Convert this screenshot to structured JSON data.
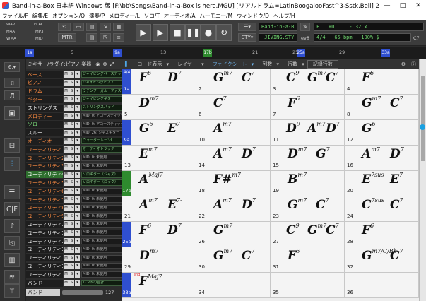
{
  "window": {
    "title": "Band-in-a-Box 日本語 Windows 版 [F:\\bb\\Songs\\Band-in-a-Box is here.MGU] [リアルドラム=LatinBoogalooFast^3-Sstk,Bell]  2:12 [ジャイビング アップビー...",
    "min": "—",
    "max": "□",
    "close": "✕"
  },
  "menu": [
    "ファイル/F",
    "編集/E",
    "オプション/O",
    "演奏/P",
    "メロディー/L",
    "ソロ/T",
    "オーディオ/A",
    "ハーモニー/M",
    "ウィンドウ/D",
    "ヘルプ/H"
  ],
  "toolbar": {
    "formats": [
      "WAV",
      "FLAC",
      "M4A",
      "MP3",
      "WMA",
      "MID"
    ],
    "mtr_label": "MTR",
    "song_name": "Band-in-a-B...",
    "style_name": "_JIVING.STY",
    "key": "F",
    "plus_label": "+0",
    "bar_from": "1",
    "bar_to": "32",
    "x_label": "x",
    "repeats": "1",
    "ev_label": "ev8",
    "time_sig": "4/4",
    "tempo": "65 bpm",
    "volume": "100%",
    "dollar_label": "$",
    "c7_label": "C7"
  },
  "timeline": {
    "ticks": [
      "5",
      "9",
      "13",
      "17",
      "21",
      "25",
      "29",
      "33"
    ],
    "markers": [
      "1a",
      "9a",
      "17b",
      "25a",
      "33a"
    ]
  },
  "mixer": {
    "header": "ミキサー/ラダイ:ピアノ 楽器",
    "tracks": [
      {
        "name": "ベース",
        "inst": "ジャイビングベースアップライト",
        "color": "orange",
        "sel": false
      },
      {
        "name": "ピアノ",
        "inst": "ジャイビングピアノ",
        "color": "orange",
        "sel": false
      },
      {
        "name": "ドラム",
        "inst": "ラテンブーガルーファスト",
        "color": "orange",
        "sel": false
      },
      {
        "name": "ギター",
        "inst": "ジャイビングギター",
        "color": "orange",
        "sel": false
      },
      {
        "name": "ストリングス",
        "inst": "ストリングスパッド",
        "color": "white",
        "sel": false
      },
      {
        "name": "メロディー",
        "inst": "MIDI 0: アコースティック",
        "color": "orange",
        "sel": false
      },
      {
        "name": "ソロ",
        "inst": "MIDI 0: アコースティック",
        "color": "green",
        "sel": false
      },
      {
        "name": "スルー",
        "inst": "MIDI 26: ジャズギター",
        "color": "white",
        "sel": false
      },
      {
        "name": "オーディオ",
        "inst": "ウォータートーンⅡ",
        "color": "orange",
        "sel": false
      },
      {
        "name": "ユーティリティ1",
        "inst": "オーディオトラック",
        "color": "orange",
        "sel": false
      },
      {
        "name": "ユーティリティ2",
        "inst": "MIDI 0: 未使用",
        "color": "orange",
        "sel": false
      },
      {
        "name": "ユーティリティ3",
        "inst": "MIDI 0: 未使用",
        "color": "orange",
        "sel": false
      },
      {
        "name": "ユーティリティ4",
        "inst": "ソロギター（ジャズ）",
        "color": "white",
        "sel": true
      },
      {
        "name": "ユーティリティ5",
        "inst": "ソロギター（ロック）",
        "color": "orange",
        "sel": false
      },
      {
        "name": "ユーティリティ6",
        "inst": "MIDI 0: 未使用",
        "color": "orange",
        "sel": false
      },
      {
        "name": "ユーティリティ7",
        "inst": "MIDI 0: 未使用",
        "color": "orange",
        "sel": false
      },
      {
        "name": "ユーティリティ8",
        "inst": "MIDI 0: 未使用",
        "color": "orange",
        "sel": false
      },
      {
        "name": "ユーティリティ9",
        "inst": "MIDI 0: 未使用",
        "color": "orange",
        "sel": false
      },
      {
        "name": "ユーティリティ10",
        "inst": "MIDI 0: 未使用",
        "color": "white",
        "sel": false
      },
      {
        "name": "ユーティリティ11",
        "inst": "MIDI 0: 未使用",
        "color": "white",
        "sel": false
      },
      {
        "name": "ユーティリティ12",
        "inst": "MIDI 0: 未使用",
        "color": "white",
        "sel": false
      },
      {
        "name": "ユーティリティ13",
        "inst": "MIDI 0: 未使用",
        "color": "white",
        "sel": false
      },
      {
        "name": "ユーティリティ14",
        "inst": "MIDI 0: 未使用",
        "color": "white",
        "sel": false
      },
      {
        "name": "ユーティリティ15",
        "inst": "MIDI 0: 未使用",
        "color": "white",
        "sel": false
      },
      {
        "name": "ユーティリティ16",
        "inst": "MIDI 0: 未使用",
        "color": "white",
        "sel": false
      },
      {
        "name": "バンド",
        "inst": "バンドの合計",
        "color": "white",
        "sel": false
      }
    ],
    "band_label": "バンド",
    "band_value": "127"
  },
  "sheet": {
    "header": [
      "コード表示",
      "レイヤー",
      "フェイクシート",
      "列数",
      "行数",
      "記録行数"
    ],
    "time_sig": "4/4",
    "cells": [
      {
        "bar": "1",
        "part": "1a",
        "chords": [
          [
            "F",
            "6"
          ],
          [
            "D",
            "7"
          ]
        ]
      },
      {
        "bar": "2",
        "chords": [
          [
            "G",
            "m7"
          ],
          [
            "C",
            "7"
          ]
        ]
      },
      {
        "bar": "3",
        "chords": [
          [
            "C",
            "9"
          ],
          [
            "G",
            "m7"
          ],
          [
            "C",
            "7"
          ]
        ]
      },
      {
        "bar": "4",
        "chords": [
          [
            "F",
            "6"
          ]
        ]
      },
      {
        "bar": "5",
        "chords": [
          [
            "D",
            "m7"
          ]
        ]
      },
      {
        "bar": "6",
        "chords": [
          [
            "C",
            "7"
          ]
        ]
      },
      {
        "bar": "7",
        "chords": [
          [
            "F",
            "6"
          ]
        ]
      },
      {
        "bar": "8",
        "chords": [
          [
            "G",
            "m7"
          ],
          [
            "C",
            "7"
          ]
        ]
      },
      {
        "bar": "9",
        "part": "9a",
        "chords": [
          [
            "G",
            "6"
          ],
          [
            "E",
            "7"
          ]
        ]
      },
      {
        "bar": "10",
        "chords": [
          [
            "A",
            "m7"
          ]
        ]
      },
      {
        "bar": "11",
        "chords": [
          [
            "D",
            "9"
          ],
          [
            "A",
            "m7"
          ],
          [
            "D",
            "7"
          ]
        ]
      },
      {
        "bar": "12",
        "chords": [
          [
            "G",
            "6"
          ]
        ]
      },
      {
        "bar": "13",
        "chords": [
          [
            "E",
            "m7"
          ]
        ]
      },
      {
        "bar": "14",
        "chords": [
          [
            "A",
            "m7"
          ],
          [
            "D",
            "7"
          ]
        ]
      },
      {
        "bar": "15",
        "chords": [
          [
            "D",
            "m7"
          ],
          [
            "G",
            "7"
          ]
        ]
      },
      {
        "bar": "16",
        "chords": [
          [
            "A",
            "m7"
          ],
          [
            "D",
            "7"
          ]
        ]
      },
      {
        "bar": "17",
        "part": "17b",
        "chords": [
          [
            "A",
            "Maj7"
          ]
        ]
      },
      {
        "bar": "18",
        "chords": [
          [
            "F#",
            "m7"
          ]
        ]
      },
      {
        "bar": "19",
        "chords": [
          [
            "B",
            "m7"
          ]
        ]
      },
      {
        "bar": "20",
        "chords": [
          [
            "E",
            "7sus"
          ],
          [
            "E",
            "7"
          ]
        ]
      },
      {
        "bar": "21",
        "chords": [
          [
            "A",
            "m7"
          ],
          [
            "E",
            "7-"
          ]
        ]
      },
      {
        "bar": "22",
        "chords": [
          [
            "A",
            "m7"
          ],
          [
            "D",
            "7"
          ]
        ]
      },
      {
        "bar": "23",
        "chords": [
          [
            "G",
            "m7"
          ],
          [
            "C",
            "7"
          ]
        ]
      },
      {
        "bar": "24",
        "chords": [
          [
            "C",
            "7sus"
          ],
          [
            "C",
            "7"
          ]
        ]
      },
      {
        "bar": "25",
        "part": "25a",
        "chords": [
          [
            "F",
            "6"
          ],
          [
            "D",
            "7"
          ]
        ]
      },
      {
        "bar": "26",
        "chords": [
          [
            "G",
            "m7"
          ]
        ]
      },
      {
        "bar": "27",
        "chords": [
          [
            "C",
            "9"
          ],
          [
            "G",
            "m7"
          ],
          [
            "C",
            "7"
          ]
        ]
      },
      {
        "bar": "28",
        "chords": [
          [
            "F",
            "6"
          ]
        ]
      },
      {
        "bar": "29",
        "chords": [
          [
            "D",
            "m7"
          ]
        ]
      },
      {
        "bar": "30",
        "chords": [
          [
            "G",
            "m7"
          ],
          [
            "C",
            "7"
          ]
        ]
      },
      {
        "bar": "31",
        "chords": [
          [
            "F",
            "6"
          ]
        ]
      },
      {
        "bar": "32",
        "chords": [
          [
            "G",
            "m7/C/Bb"
          ],
          [
            "C",
            "7"
          ]
        ]
      },
      {
        "bar": "33",
        "part": "33a",
        "chords": [
          [
            "F",
            "Maj7"
          ]
        ],
        "remark": "end"
      },
      {
        "bar": "34",
        "chords": []
      },
      {
        "bar": "35",
        "chords": []
      },
      {
        "bar": "36",
        "chords": []
      }
    ]
  },
  "colors": {
    "accent": "#1ba1e2",
    "part_marker": "#2f4fd0",
    "part_b": "#2e8a2e",
    "track_name": "#ff8c42"
  }
}
